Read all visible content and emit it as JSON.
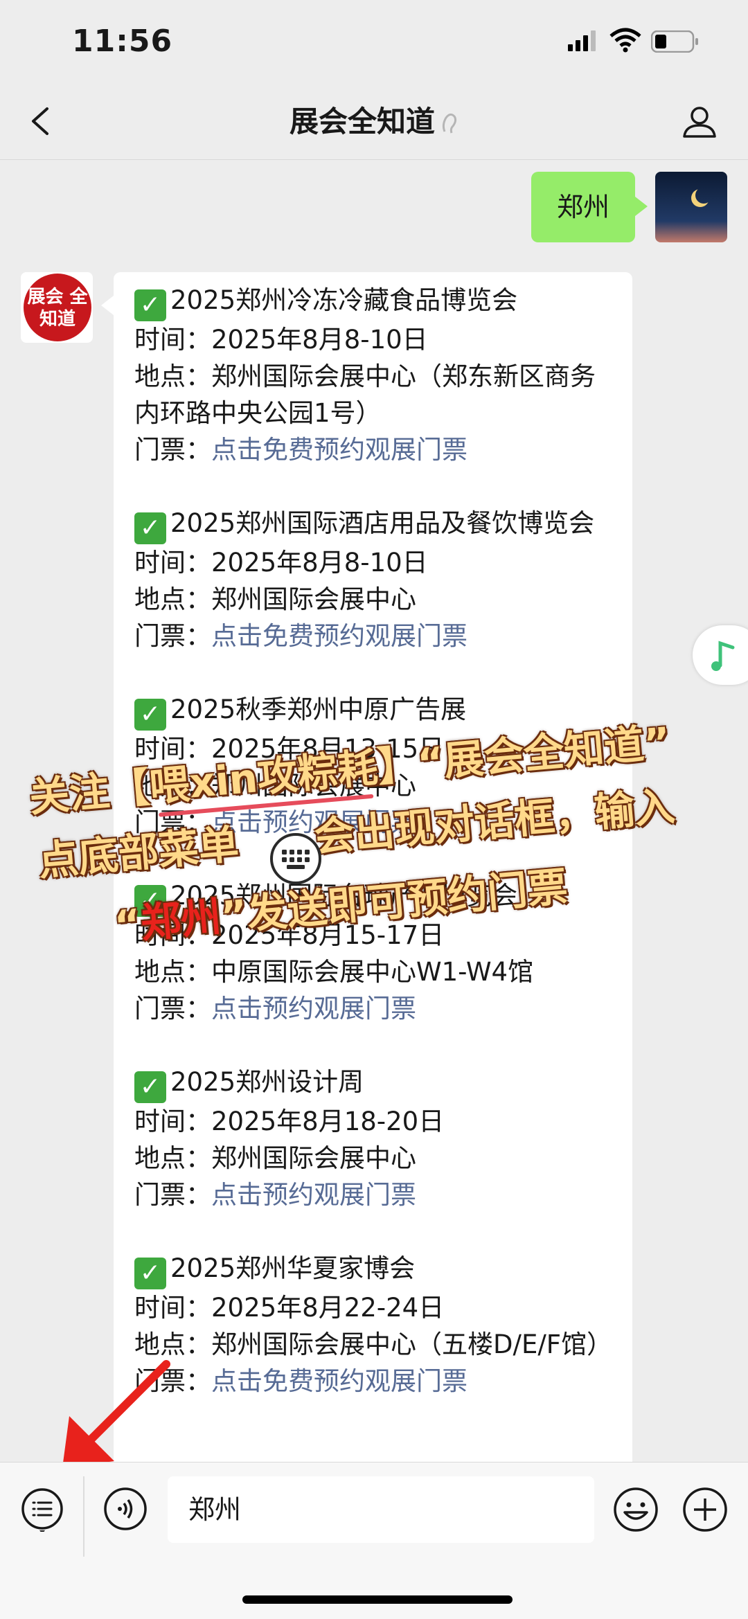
{
  "status_bar": {
    "time": "11:56"
  },
  "nav": {
    "title": "展会全知道"
  },
  "user_message": {
    "text": "郑州"
  },
  "bot": {
    "avatar_text": "展会 全知道",
    "events": [
      {
        "title": "2025郑州冷冻冷藏食品博览会",
        "time_label": "时间：",
        "time": "2025年8月8-10日",
        "place_label": "地点：",
        "place": "郑州国际会展中心（郑东新区商务内环路中央公园1号）",
        "ticket_label": "门票：",
        "ticket_link": "点击免费预约观展门票"
      },
      {
        "title": "2025郑州国际酒店用品及餐饮博览会",
        "time_label": "时间：",
        "time": "2025年8月8-10日",
        "place_label": "地点：",
        "place": "郑州国际会展中心",
        "ticket_label": "门票：",
        "ticket_link": "点击免费预约观展门票"
      },
      {
        "title": "2025秋季郑州中原广告展",
        "time_label": "时间：",
        "time": "2025年8月13-15日",
        "place_label": "地点：",
        "place": "郑州国际会展中心",
        "ticket_label": "门票：",
        "ticket_link": "点击预约观展门票"
      },
      {
        "title": "2025郑州国际台球产业博览会",
        "time_label": "时间：",
        "time": "2025年8月15-17日",
        "place_label": "地点：",
        "place": "中原国际会展中心W1-W4馆",
        "ticket_label": "门票：",
        "ticket_link": "点击预约观展门票"
      },
      {
        "title": "2025郑州设计周",
        "time_label": "时间：",
        "time": "2025年8月18-20日",
        "place_label": "地点：",
        "place": "郑州国际会展中心",
        "ticket_label": "门票：",
        "ticket_link": "点击预约观展门票"
      },
      {
        "title": "2025郑州华夏家博会",
        "time_label": "时间：",
        "time": "2025年8月22-24日",
        "place_label": "地点：",
        "place": "郑州国际会展中心（五楼D/E/F馆）",
        "ticket_label": "门票：",
        "ticket_link": "点击免费预约观展门票"
      }
    ]
  },
  "overlay": {
    "line1_a": "关注【",
    "line1_b": "喂xin攻粽耗",
    "line1_c": "】“展会全知道”",
    "line2_a": "点底部菜单",
    "line2_b": "会出现对话框，输入",
    "line3_a": "“",
    "line3_b": "郑州",
    "line3_c": "”发送即可预约门票"
  },
  "input_bar": {
    "value": "郑州"
  },
  "icons": [
    "back-arrow-icon",
    "ear-icon",
    "profile-icon",
    "check-icon",
    "music-note-icon",
    "keyboard-icon",
    "menu-list-icon",
    "voice-icon",
    "emoji-icon",
    "plus-icon",
    "red-arrow-icon",
    "red-circle-annotation"
  ],
  "colors": {
    "user_bubble": "#95ec69",
    "link": "#576b95",
    "check": "#3ea83e",
    "overlay_text": "#ffd98a",
    "overlay_red": "#e8221c"
  }
}
